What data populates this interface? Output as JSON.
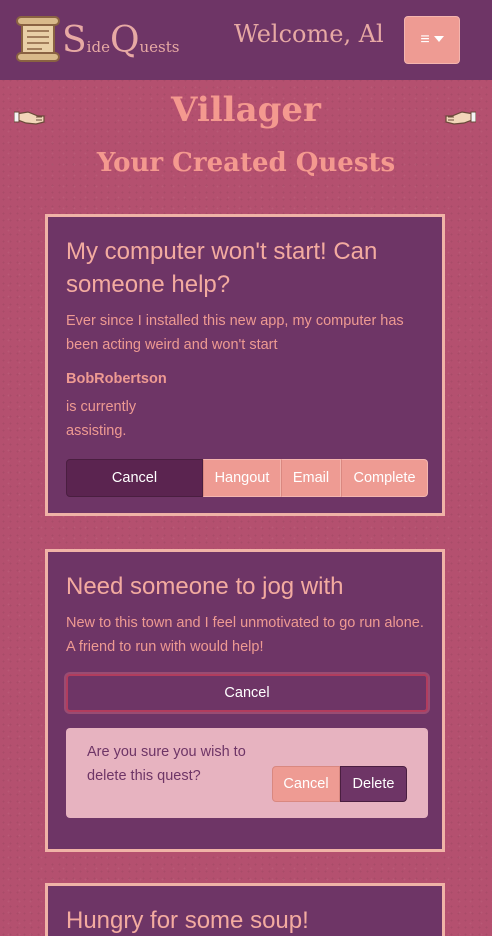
{
  "brand": {
    "s": "S",
    "ide": "ide",
    "q": "Q",
    "uests": "uests",
    "logo_icon": "scroll-icon"
  },
  "header": {
    "welcome": "Welcome, Al",
    "menu_icon": "hamburger-icon"
  },
  "page": {
    "title": "Villager",
    "subtitle": "Your Created Quests",
    "decor_icon": "handshake-icon"
  },
  "colors": {
    "navbar": "#6e3566",
    "background": "#b4506f",
    "accent": "#ee9b93",
    "title": "#f4998f"
  },
  "quests": [
    {
      "title": "My computer won't start! Can someone help?",
      "description": "Ever since I installed this new app, my computer has been acting weird and won't start",
      "helper": "BobRobertson",
      "helper_status": "is currently assisting.",
      "buttons": {
        "cancel": "Cancel",
        "hangout": "Hangout",
        "email": "Email",
        "complete": "Complete"
      }
    },
    {
      "title": "Need someone to jog with",
      "description": "New to this town and I feel unmotivated to go run alone. A friend to run with would help!",
      "cancel_label": "Cancel",
      "confirm": {
        "text": "Are you sure you wish to delete this quest?",
        "cancel": "Cancel",
        "delete": "Delete"
      }
    },
    {
      "title": "Hungry for some soup!"
    }
  ]
}
